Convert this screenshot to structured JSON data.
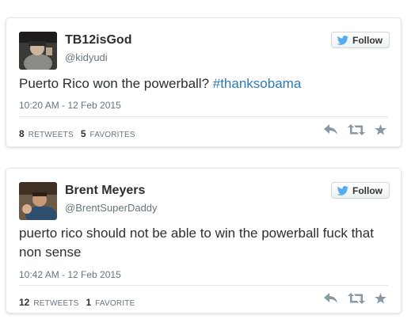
{
  "tweets": [
    {
      "name": "TB12isGod",
      "handle": "@kidyudi",
      "follow_label": "Follow",
      "text_before": "Puerto Rico won the powerball? ",
      "hashtag": "#thanksobama",
      "timestamp": "10:20 AM - 12 Feb 2015",
      "retweets_count": "8",
      "retweets_label": "RETWEETS",
      "favorites_count": "5",
      "favorites_label": "FAVORITES"
    },
    {
      "name": "Brent Meyers",
      "handle": "@BrentSuperDaddy",
      "follow_label": "Follow",
      "text": "puerto rico should not be able to win the powerball fuck that non sense",
      "timestamp": "10:42 AM - 12 Feb 2015",
      "retweets_count": "12",
      "retweets_label": "RETWEETS",
      "favorites_count": "1",
      "favorites_label": "FAVORITE"
    }
  ],
  "icons": {
    "follow": "twitter-bird-icon",
    "reply": "reply-icon",
    "retweet": "retweet-icon",
    "favorite": "star-icon"
  },
  "colors": {
    "twitter_blue": "#55acee",
    "hashtag": "#2b7bb9",
    "action_gray": "#8899a6",
    "muted_text": "#66757f"
  }
}
